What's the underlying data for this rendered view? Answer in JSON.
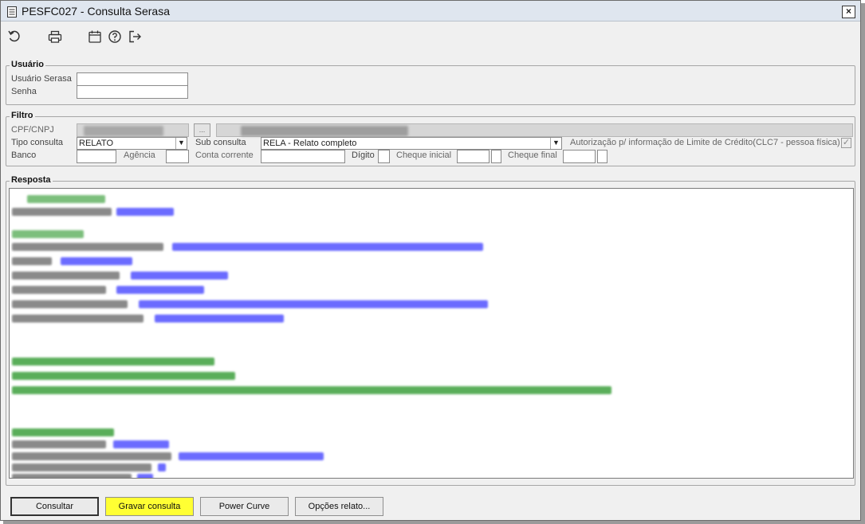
{
  "window": {
    "title": "PESFC027 - Consulta Serasa",
    "close_label": "×"
  },
  "toolbar": {
    "icons": [
      "undo-icon",
      "print-icon",
      "calendar-icon",
      "help-icon",
      "exit-icon"
    ]
  },
  "usuario": {
    "group_label": "Usuário",
    "user_label": "Usuário Serasa",
    "user_value": "",
    "password_label": "Senha",
    "password_value": ""
  },
  "filtro": {
    "group_label": "Filtro",
    "cpf_label": "CPF/CNPJ",
    "lookup_label": "...",
    "tipo_label": "Tipo consulta",
    "tipo_value": "RELATO",
    "sub_label": "Sub consulta",
    "sub_value": "RELA - Relato completo",
    "autorizacao_label": "Autorização p/ informação de Limite de Crédito(CLC7 - pessoa física)",
    "autorizacao_checked": "✓",
    "banco_label": "Banco",
    "agencia_label": "Agência",
    "conta_label": "Conta corrente",
    "digito_label": "Dígito",
    "cheque_inicial_label": "Cheque inicial",
    "cheque_final_label": "Cheque final",
    "arrow": "▼"
  },
  "resposta": {
    "group_label": "Resposta"
  },
  "buttons": {
    "consultar": "Consultar",
    "gravar": "Gravar consulta",
    "power_curve": "Power Curve",
    "opcoes": "Opções relato..."
  },
  "colors": {
    "gravar_bg": "#ffff33",
    "title_bg": "#dfe6ef"
  }
}
